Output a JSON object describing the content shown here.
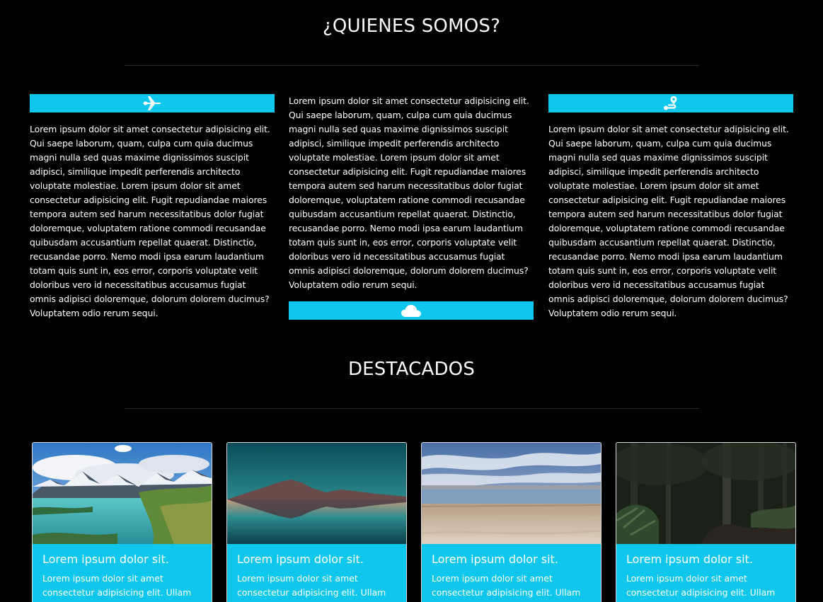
{
  "about": {
    "title": "¿QUIENES SOMOS?",
    "columns": [
      {
        "icon": "airplane-icon",
        "text": "Lorem ipsum dolor sit amet consectetur adipisicing elit. Qui saepe laborum, quam, culpa cum quia ducimus magni nulla sed quas maxime dignissimos suscipit adipisci, similique impedit perferendis architecto voluptate molestiae. Lorem ipsum dolor sit amet consectetur adipisicing elit. Fugit repudiandae maiores tempora autem sed harum necessitatibus dolor fugiat doloremque, voluptatem ratione commodi recusandae quibusdam accusantium repellat quaerat. Distinctio, recusandae porro. Nemo modi ipsa earum laudantium totam quis sunt in, eos error, corporis voluptate velit doloribus vero id necessitatibus accusamus fugiat omnis adipisci doloremque, dolorum dolorem ducimus? Voluptatem odio rerum sequi."
      },
      {
        "icon": "cloud-icon",
        "text": "Lorem ipsum dolor sit amet consectetur adipisicing elit. Qui saepe laborum, quam, culpa cum quia ducimus magni nulla sed quas maxime dignissimos suscipit adipisci, similique impedit perferendis architecto voluptate molestiae. Lorem ipsum dolor sit amet consectetur adipisicing elit. Fugit repudiandae maiores tempora autem sed harum necessitatibus dolor fugiat doloremque, voluptatem ratione commodi recusandae quibusdam accusantium repellat quaerat. Distinctio, recusandae porro. Nemo modi ipsa earum laudantium totam quis sunt in, eos error, corporis voluptate velit doloribus vero id necessitatibus accusamus fugiat omnis adipisci doloremque, dolorum dolorem ducimus? Voluptatem odio rerum sequi."
      },
      {
        "icon": "route-icon",
        "text": "Lorem ipsum dolor sit amet consectetur adipisicing elit. Qui saepe laborum, quam, culpa cum quia ducimus magni nulla sed quas maxime dignissimos suscipit adipisci, similique impedit perferendis architecto voluptate molestiae. Lorem ipsum dolor sit amet consectetur adipisicing elit. Fugit repudiandae maiores tempora autem sed harum necessitatibus dolor fugiat doloremque, voluptatem ratione commodi recusandae quibusdam accusantium repellat quaerat. Distinctio, recusandae porro. Nemo modi ipsa earum laudantium totam quis sunt in, eos error, corporis voluptate velit doloribus vero id necessitatibus accusamus fugiat omnis adipisci doloremque, dolorum dolorem ducimus? Voluptatem odio rerum sequi."
      }
    ]
  },
  "featured": {
    "title": "DESTACADOS",
    "cards": [
      {
        "image": "mountain-lake-photo",
        "title": "Lorem ipsum dolor sit.",
        "text": "Lorem ipsum dolor sit amet consectetur adipisicing elit. Ullam"
      },
      {
        "image": "sunset-reflection-photo",
        "title": "Lorem ipsum dolor sit.",
        "text": "Lorem ipsum dolor sit amet consectetur adipisicing elit. Ullam"
      },
      {
        "image": "salt-flat-photo",
        "title": "Lorem ipsum dolor sit.",
        "text": "Lorem ipsum dolor sit amet consectetur adipisicing elit. Ullam"
      },
      {
        "image": "dark-forest-photo",
        "title": "Lorem ipsum dolor sit.",
        "text": "Lorem ipsum dolor sit amet consectetur adipisicing elit. Ullam"
      }
    ]
  },
  "colors": {
    "background": "#000000",
    "accent": "#0fc7ec",
    "text": "#ffffff",
    "divider": "#2b2b2b"
  }
}
